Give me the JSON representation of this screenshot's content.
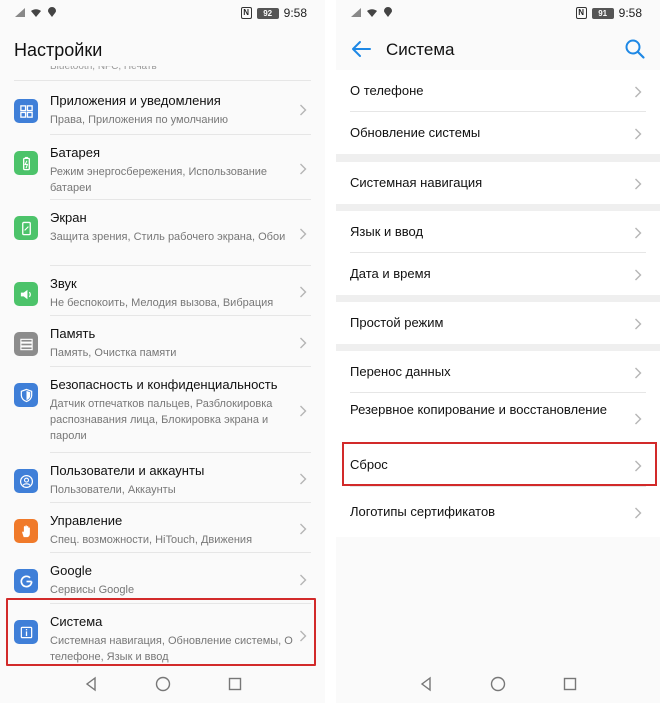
{
  "status_left": {
    "time": "9:58",
    "battery": "92"
  },
  "status_right": {
    "time": "9:58",
    "battery": "91"
  },
  "left_screen": {
    "title": "Настройки",
    "cut_item_subtitle": "Bluetooth, NFC, Печать",
    "items": [
      {
        "title": "Приложения и уведомления",
        "subtitle": "Права, Приложения по умолчанию",
        "icon": "apps-icon",
        "color": "#3f7fd8"
      },
      {
        "title": "Батарея",
        "subtitle": "Режим энергосбережения, Использование батареи",
        "icon": "battery-icon",
        "color": "#4cc36a"
      },
      {
        "title": "Экран",
        "subtitle": "Защита зрения, Стиль рабочего экрана, Обои",
        "icon": "display-icon",
        "color": "#4cc36a"
      },
      {
        "title": "Звук",
        "subtitle": "Не беспокоить, Мелодия вызова, Вибрация",
        "icon": "sound-icon",
        "color": "#4cc36a"
      },
      {
        "title": "Память",
        "subtitle": "Память, Очистка памяти",
        "icon": "storage-icon",
        "color": "#8c8c8c"
      },
      {
        "title": "Безопасность и конфиденциальность",
        "subtitle": "Датчик отпечатков пальцев, Разблокировка распознавания лица, Блокировка экрана и пароли",
        "icon": "shield-icon",
        "color": "#3f7fd8"
      },
      {
        "title": "Пользователи и аккаунты",
        "subtitle": "Пользователи, Аккаунты",
        "icon": "user-icon",
        "color": "#3f7fd8"
      },
      {
        "title": "Управление",
        "subtitle": "Спец. возможности, HiTouch, Движения",
        "icon": "hand-icon",
        "color": "#f07a2a"
      },
      {
        "title": "Google",
        "subtitle": "Сервисы Google",
        "icon": "google-icon",
        "color": "#3f7fd8"
      },
      {
        "title": "Система",
        "subtitle": "Системная навигация, Обновление системы, О телефоне, Язык и ввод",
        "icon": "info-icon",
        "color": "#3f7fd8"
      }
    ]
  },
  "right_screen": {
    "title": "Система",
    "items": [
      {
        "title": "О телефоне"
      },
      {
        "title": "Обновление системы"
      },
      {
        "title": "Системная навигация"
      },
      {
        "title": "Язык и ввод"
      },
      {
        "title": "Дата и время"
      },
      {
        "title": "Простой режим"
      },
      {
        "title": "Перенос данных"
      },
      {
        "title": "Резервное копирование и восстановление"
      },
      {
        "title": "Сброс"
      },
      {
        "title": "Логотипы сертификатов"
      }
    ]
  },
  "colors": {
    "accent": "#1e88e5",
    "highlight": "#d22a2a"
  }
}
